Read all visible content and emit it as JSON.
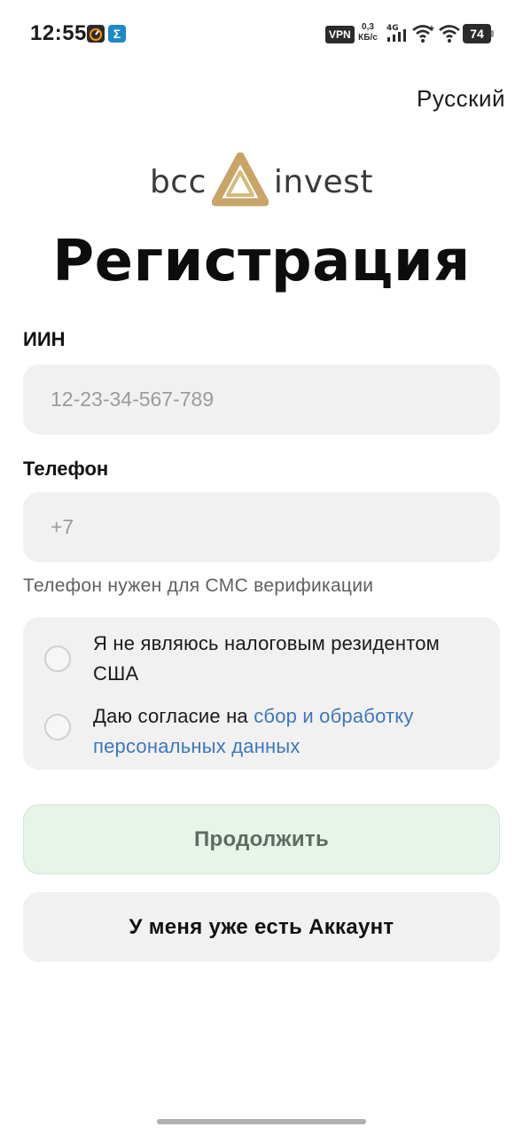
{
  "status_bar": {
    "time": "12:55",
    "vpn": "VPN",
    "net_speed_value": "0,3",
    "net_speed_unit": "КБ/с",
    "network_type": "4G",
    "battery": "74"
  },
  "language": "Русский",
  "logo": {
    "left": "bcc",
    "right": "invest"
  },
  "title": "Регистрация",
  "iin": {
    "label": "ИИН",
    "placeholder": "12-23-34-567-789"
  },
  "phone": {
    "label": "Телефон",
    "placeholder": "+7",
    "hint": "Телефон нужен для СМС верификации"
  },
  "consents": {
    "tax": {
      "text": "Я не являюсь налоговым резидентом США",
      "checked": false
    },
    "personal": {
      "text_prefix": "Даю согласие на ",
      "link": "сбор и обработку персональных данных",
      "checked": false
    }
  },
  "buttons": {
    "continue": "Продолжить",
    "have_account": "У меня уже есть Аккаунт"
  },
  "colors": {
    "brand_gold": "#c8a567",
    "link": "#3c78c0",
    "continue_bg": "#e8f3ea",
    "field_bg": "#f1f1f1"
  }
}
